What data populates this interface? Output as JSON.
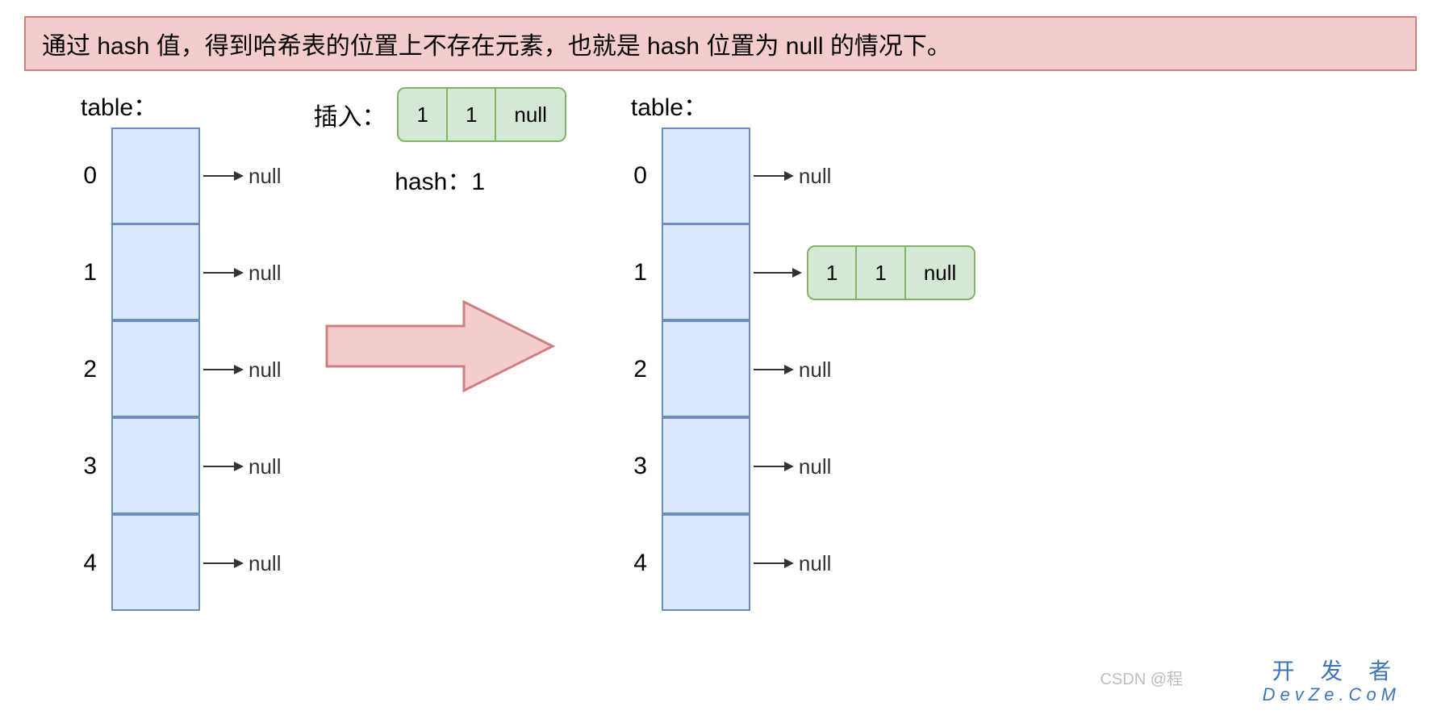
{
  "banner": "通过 hash 值，得到哈希表的位置上不存在元素，也就是 hash 位置为 null 的情况下。",
  "left": {
    "title": "table：",
    "rows": [
      {
        "index": "0",
        "link": "null"
      },
      {
        "index": "1",
        "link": "null"
      },
      {
        "index": "2",
        "link": "null"
      },
      {
        "index": "3",
        "link": "null"
      },
      {
        "index": "4",
        "link": "null"
      }
    ]
  },
  "mid": {
    "insert_label": "插入：",
    "node": {
      "key": "1",
      "value": "1",
      "next": "null"
    },
    "hash_label": "hash：1"
  },
  "right": {
    "title": "table：",
    "rows": [
      {
        "index": "0",
        "link_type": "null",
        "link": "null"
      },
      {
        "index": "1",
        "link_type": "node",
        "node": {
          "key": "1",
          "value": "1",
          "next": "null"
        }
      },
      {
        "index": "2",
        "link_type": "null",
        "link": "null"
      },
      {
        "index": "3",
        "link_type": "null",
        "link": "null"
      },
      {
        "index": "4",
        "link_type": "null",
        "link": "null"
      }
    ]
  },
  "watermark": {
    "line1": "开 发 者",
    "line2": "DevZe.CoM",
    "csdn": "CSDN @程"
  }
}
